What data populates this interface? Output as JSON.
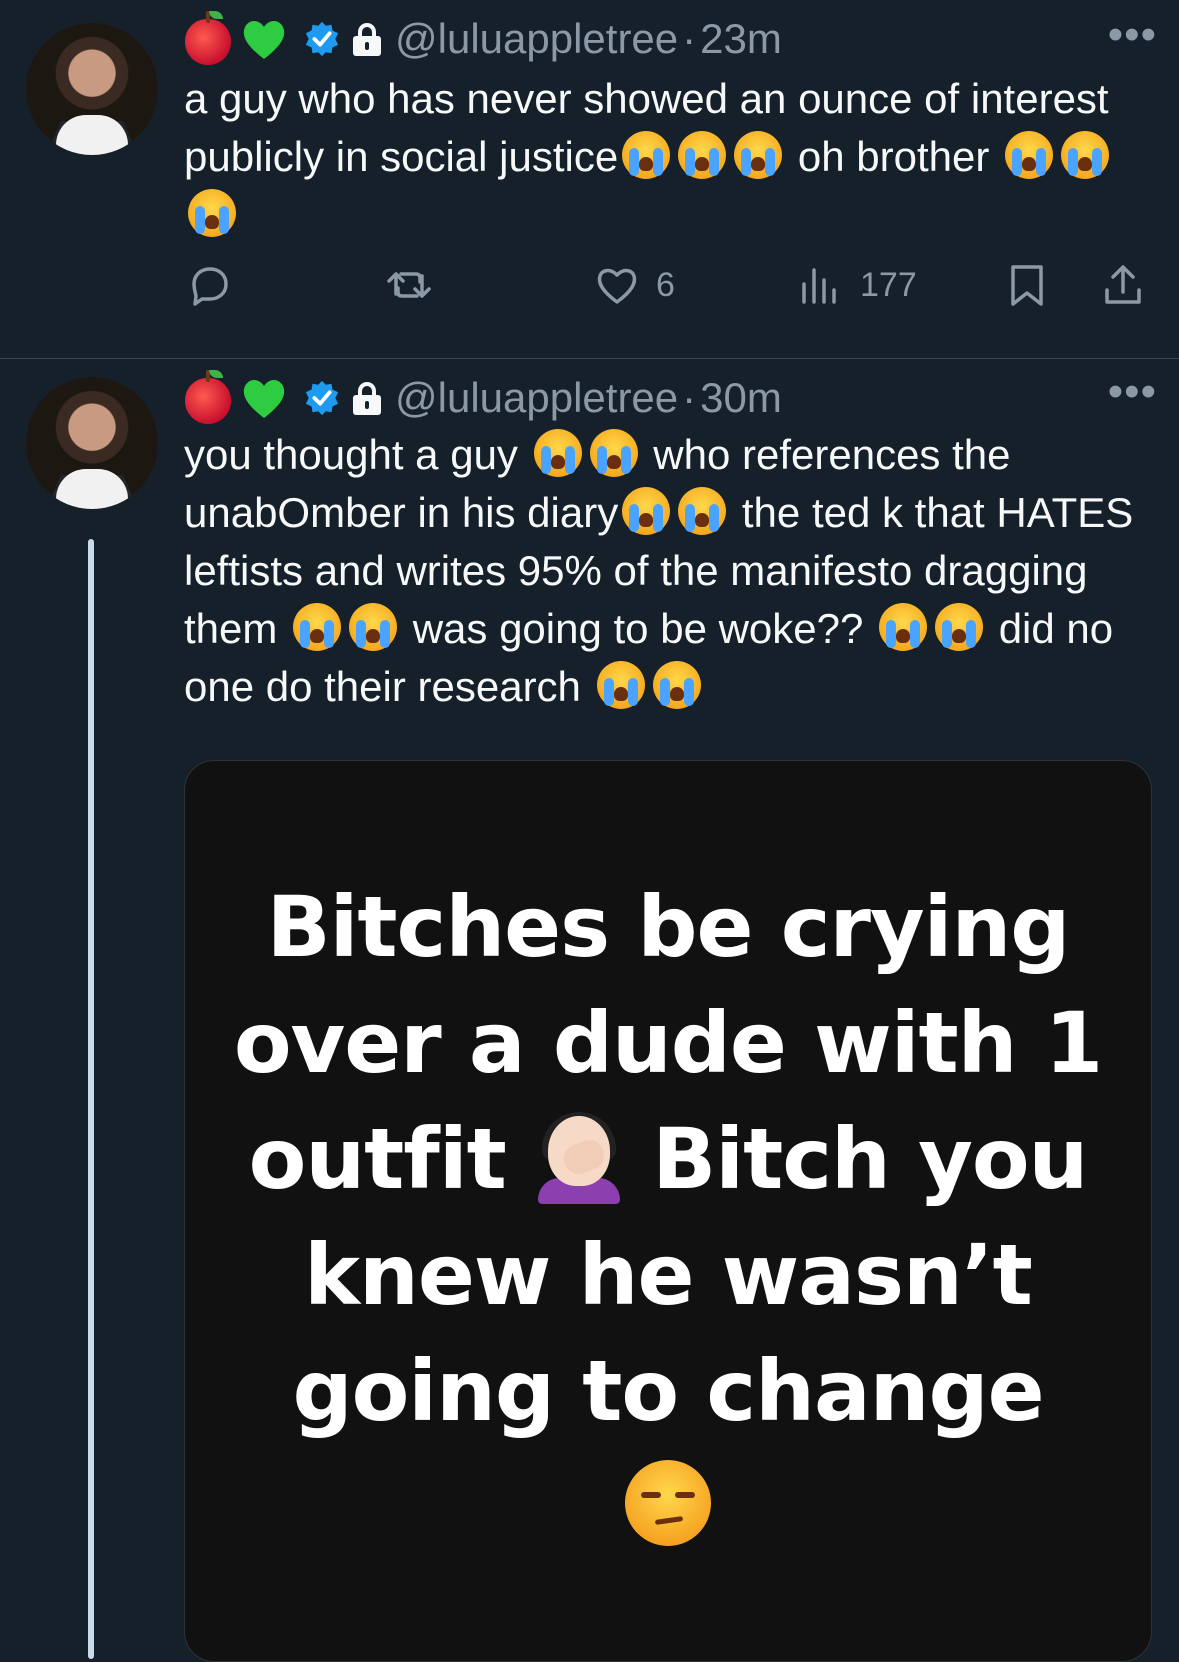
{
  "tweets": [
    {
      "handle": "@luluappletree",
      "separator": "·",
      "time": "23m",
      "text_parts": [
        "a guy who has never showed an ounce of interest publicly in social justice",
        "oh brother"
      ],
      "actions": {
        "reply_count": "",
        "retweet_count": "",
        "like_count": "6",
        "view_count": "177"
      }
    },
    {
      "handle": "@luluappletree",
      "separator": "·",
      "time": "30m",
      "text_parts": [
        "you thought a guy",
        "who references the unabOmber in his diary",
        "the ted k that HATES leftists and writes 95% of the manifesto dragging them",
        "was going to be woke??",
        "did no one do their research"
      ],
      "media": {
        "text_line1": "Bitches be crying",
        "text_line2": "over a dude with 1",
        "text_line3a": "outfit",
        "text_line3b": "Bitch you",
        "text_line4": "knew he wasn’t",
        "text_line5": "going to change"
      }
    }
  ],
  "icons": {
    "emoji_apple": "red-apple",
    "emoji_heart": "green-heart",
    "verified": "verified-badge",
    "lock": "lock",
    "cry": "loudly-crying-face",
    "facepalm": "woman-facepalming",
    "unamused": "unamused-face"
  },
  "colors": {
    "background": "#15202b",
    "text": "#f7f9f9",
    "muted": "#8b98a5",
    "verified": "#1d9bf0",
    "green_heart": "#2ecc40"
  }
}
